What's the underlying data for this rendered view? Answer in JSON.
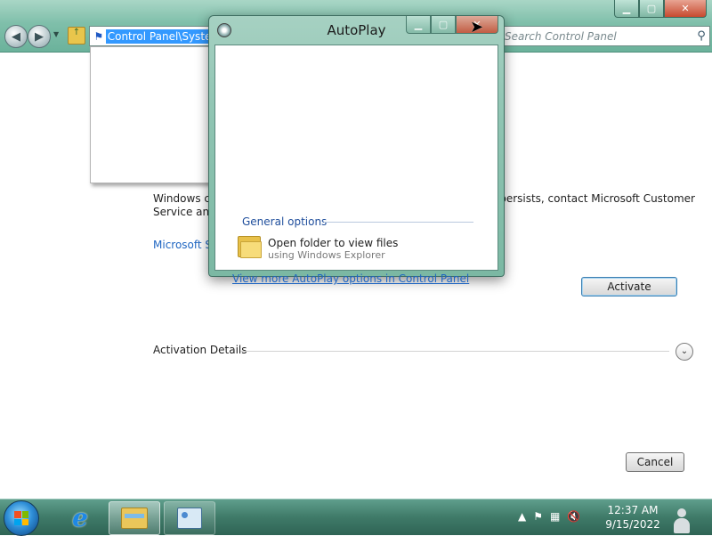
{
  "explorer": {
    "address_text": "Control Panel\\System",
    "search_placeholder": "Search Control Panel",
    "content_left_text": "Windows ca\nService and S",
    "content_right_text": "e persists, contact Microsoft Customer",
    "ms_link": "Microsoft So",
    "activate_label": "Activate",
    "details_label": "Activation Details",
    "cancel_label": "Cancel"
  },
  "autoplay": {
    "title": "AutoPlay",
    "section_label": "General options",
    "option_main": "Open folder to view files",
    "option_sub": "using Windows Explorer",
    "more_link": "View more AutoPlay options in Control Panel"
  },
  "taskbar": {
    "time": "12:37 AM",
    "date": "9/15/2022"
  },
  "colors": {
    "title_bar": "#7fbfaa",
    "link": "#1f66c2",
    "selection": "#3399ff",
    "taskbar": "#3f7a68"
  }
}
